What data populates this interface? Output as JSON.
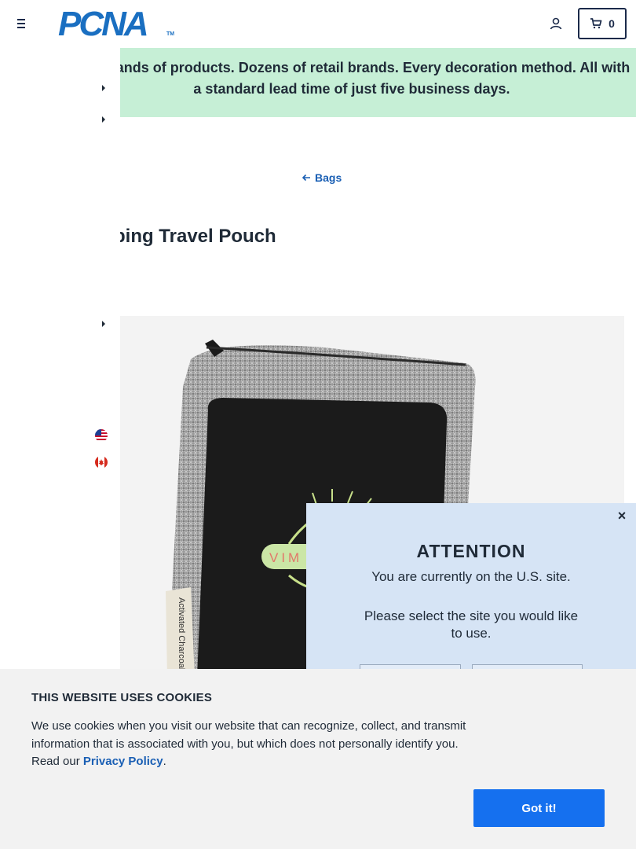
{
  "header": {
    "logo_text": "PCNA",
    "logo_tm": "TM",
    "cart_count": "0",
    "icons": {
      "menu": "hamburger-menu-icon",
      "account": "user-icon",
      "cart": "shopping-cart-icon"
    }
  },
  "announcement": {
    "text": "Thousands of products. Dozens of retail brands. Every decoration method. All with a standard lead time of just five business days."
  },
  "breadcrumb": {
    "label": "Bags",
    "icon": "arrow-left-icon"
  },
  "product": {
    "title": "Shopping Travel Pouch",
    "image_tag_text": "Activated Charcoal Air Purifier",
    "image_logo_text": "VIM A"
  },
  "site_modal": {
    "title": "ATTENTION",
    "line1": "You are currently on the U.S. site.",
    "line2": "Please select the site you would like to use.",
    "close_label": "×",
    "icons": {
      "us": "us-flag-icon",
      "ca": "canada-flag-icon"
    }
  },
  "cookie_banner": {
    "title": "THIS WEBSITE USES COOKIES",
    "text_before": "We use cookies when you visit our website that can recognize, collect, and transmit information that is associated with you, but which does not personally identify you. Read our ",
    "link_label": "Privacy Policy",
    "text_after": ".",
    "button_label": "Got it!"
  },
  "colors": {
    "brand_blue": "#1a6fc1",
    "announcement_bg": "#c6efd6",
    "modal_bg": "#d6e4f5",
    "cookie_button": "#1570ef"
  }
}
